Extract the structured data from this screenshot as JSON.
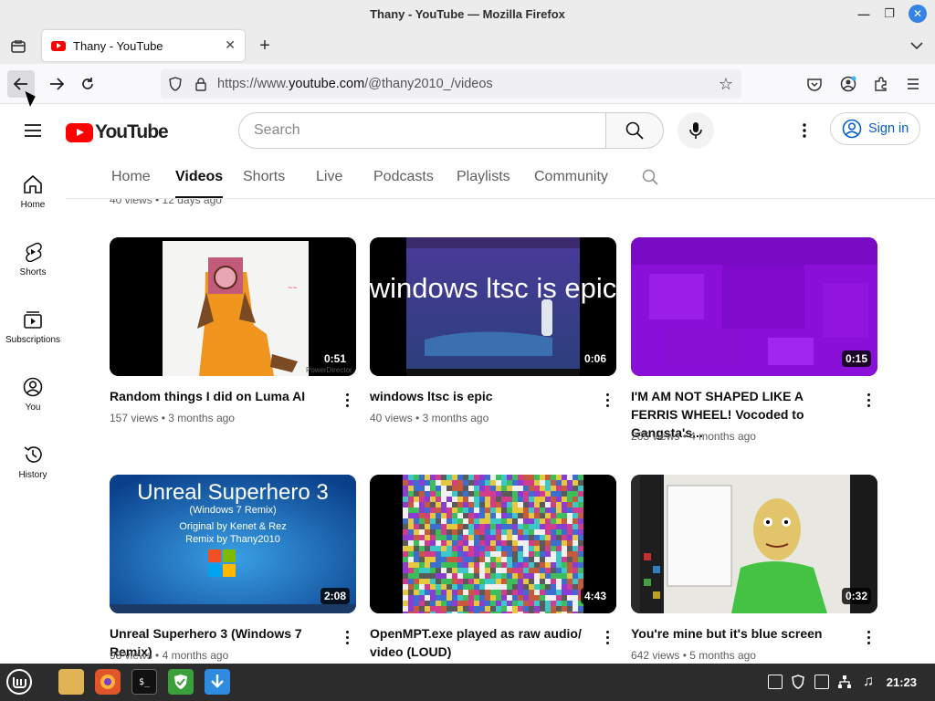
{
  "window": {
    "title": "Thany - YouTube — Mozilla Firefox"
  },
  "browser": {
    "tab_title": "Thany - YouTube",
    "url_prefix": "https://www.",
    "url_domain": "youtube.com",
    "url_path": "/@thany2010_/videos"
  },
  "youtube": {
    "logo_text": "YouTube",
    "search_placeholder": "Search",
    "signin_label": "Sign in",
    "sidebar": [
      {
        "label": "Home",
        "icon": "home-icon"
      },
      {
        "label": "Shorts",
        "icon": "shorts-icon"
      },
      {
        "label": "Subscriptions",
        "icon": "subscriptions-icon"
      },
      {
        "label": "You",
        "icon": "you-icon"
      },
      {
        "label": "History",
        "icon": "history-icon"
      }
    ],
    "channel_tabs": [
      "Home",
      "Videos",
      "Shorts",
      "Live",
      "Podcasts",
      "Playlists",
      "Community"
    ],
    "active_tab": "Videos",
    "previous_row_meta": "40 views • 12 days ago",
    "videos": [
      {
        "title": "Random things I did on Luma AI",
        "views": "157 views",
        "age": "3 months ago",
        "duration": "0:51",
        "thumb_text": ""
      },
      {
        "title": "windows ltsc is epic",
        "views": "40 views",
        "age": "3 months ago",
        "duration": "0:06",
        "thumb_text": "windows ltsc is epic"
      },
      {
        "title": "I'M AM NOT SHAPED LIKE A FERRIS WHEEL! Vocoded to Gangsta's...",
        "views": "265 views",
        "age": "4 months ago",
        "duration": "0:15",
        "thumb_text": ""
      },
      {
        "title": "Unreal Superhero 3 (Windows 7 Remix)",
        "views": "98 views",
        "age": "4 months ago",
        "duration": "2:08",
        "thumb_text": "Unreal Superhero 3",
        "thumb_sub": "(Windows 7 Remix)",
        "thumb_line2": "Original by Kenet & Rez",
        "thumb_line3": "Remix by Thany2010"
      },
      {
        "title": "OpenMPT.exe played as raw audio/ video (LOUD)",
        "views": "",
        "age": "",
        "duration": "4:43",
        "thumb_text": ""
      },
      {
        "title": "You're mine but it's blue screen",
        "views": "642 views",
        "age": "5 months ago",
        "duration": "0:32",
        "thumb_text": ""
      }
    ]
  },
  "taskbar": {
    "clock": "21:23"
  },
  "colors": {
    "youtube_red": "#ff0000",
    "signin_blue": "#065fd4",
    "taskbar": "#2c2c2c"
  }
}
